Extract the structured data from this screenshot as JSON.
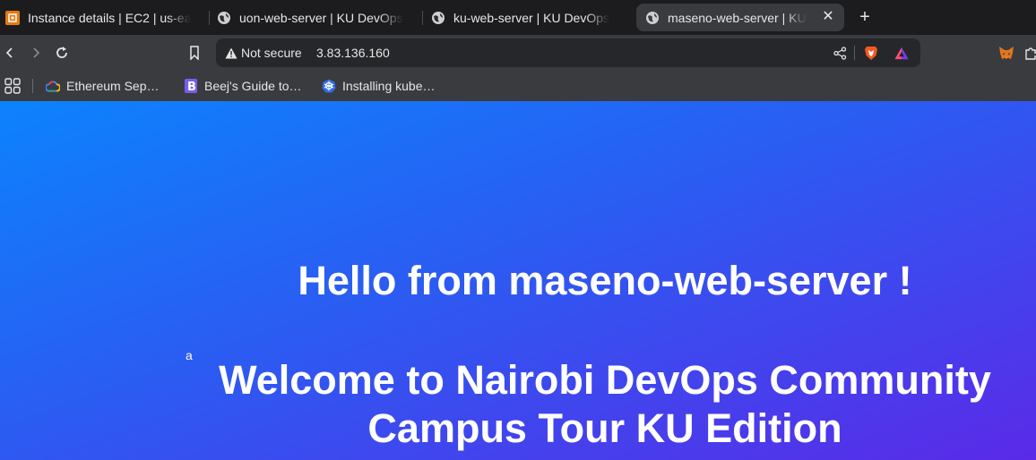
{
  "browser": {
    "tabs": [
      {
        "title": "Instance details | EC2 | us-ea",
        "favicon": "aws-icon",
        "active": false
      },
      {
        "title": "uon-web-server | KU DevOps",
        "favicon": "globe-icon",
        "active": false
      },
      {
        "title": "ku-web-server | KU DevOps",
        "favicon": "globe-icon",
        "active": false
      },
      {
        "title": "maseno-web-server | KU",
        "favicon": "globe-icon",
        "active": true
      }
    ],
    "new_tab_label": "+",
    "close_label": "✕",
    "address": {
      "security_label": "Not secure",
      "url": "3.83.136.160"
    },
    "bookmarks": [
      {
        "label": "Ethereum Sep…",
        "icon": "google-cloud-icon"
      },
      {
        "label": "Beej's Guide to…",
        "icon": "b-logo-icon"
      },
      {
        "label": "Installing kube…",
        "icon": "kubernetes-icon"
      }
    ]
  },
  "page": {
    "hello_heading": "Hello from maseno-web-server !",
    "stray_text": "a",
    "welcome_heading": "Welcome to Nairobi DevOps Community Campus Tour KU Edition"
  },
  "colors": {
    "gradient_start": "#0c83fd",
    "gradient_end": "#5a2ae8",
    "toolbar": "#3a3b3f",
    "tabstrip": "#1c1c1f",
    "brave_orange": "#f15a24"
  }
}
